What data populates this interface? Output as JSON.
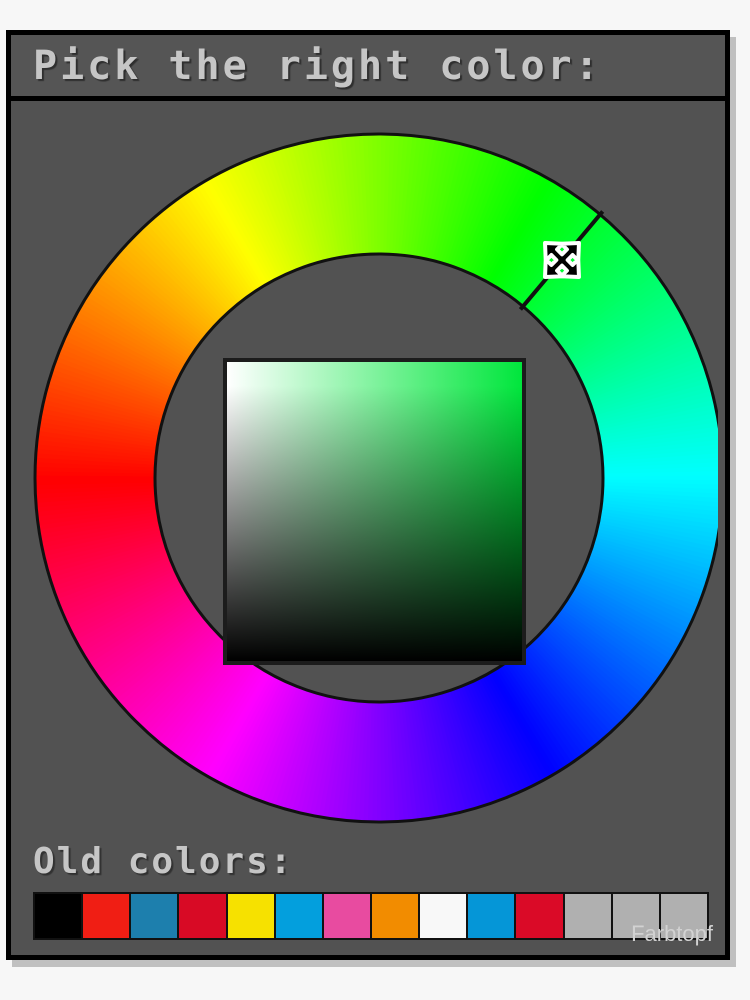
{
  "window": {
    "title": "Pick the right color:",
    "background_color": "#525252",
    "titlebar_color": "#555555",
    "border_color": "#000000",
    "text_color": "#c6c6c6",
    "page_background": "#f7f7f7"
  },
  "hue_wheel": {
    "name": "hue-ring",
    "selected_hue_degrees": 130,
    "selected_hue_color": "#00e63c",
    "outer_radius": 345,
    "inner_radius": 223,
    "stroke_color": "#111111",
    "cursor_icon": "move-resize-diagonal-cursor",
    "stops": [
      {
        "deg": 0,
        "color": "#ff0000"
      },
      {
        "deg": 30,
        "color": "#ff8000"
      },
      {
        "deg": 60,
        "color": "#ffff00"
      },
      {
        "deg": 90,
        "color": "#80ff00"
      },
      {
        "deg": 120,
        "color": "#00ff00"
      },
      {
        "deg": 150,
        "color": "#00ff80"
      },
      {
        "deg": 180,
        "color": "#00ffff"
      },
      {
        "deg": 210,
        "color": "#0080ff"
      },
      {
        "deg": 240,
        "color": "#0000ff"
      },
      {
        "deg": 270,
        "color": "#8000ff"
      },
      {
        "deg": 300,
        "color": "#ff00ff"
      },
      {
        "deg": 330,
        "color": "#ff0080"
      },
      {
        "deg": 360,
        "color": "#ff0000"
      }
    ]
  },
  "sv_square": {
    "name": "saturation-value-square",
    "hue_color": "#00e63c",
    "corner_white": "#ffffff",
    "corner_black": "#000000",
    "border_color": "#1c1c1c"
  },
  "old_colors": {
    "label": "Old colors:",
    "swatches": [
      {
        "name": "swatch-black",
        "color": "#000000"
      },
      {
        "name": "swatch-red",
        "color": "#f01e14"
      },
      {
        "name": "swatch-steel-blue",
        "color": "#1d7fad"
      },
      {
        "name": "swatch-crimson",
        "color": "#d80a25"
      },
      {
        "name": "swatch-yellow",
        "color": "#f6e100"
      },
      {
        "name": "swatch-cyan-blue",
        "color": "#039fdd"
      },
      {
        "name": "swatch-pink",
        "color": "#e84ba0"
      },
      {
        "name": "swatch-orange",
        "color": "#f28c00"
      },
      {
        "name": "swatch-white",
        "color": "#f8f8f8"
      },
      {
        "name": "swatch-blue",
        "color": "#0596d7"
      },
      {
        "name": "swatch-red-2",
        "color": "#da0a27"
      },
      {
        "name": "swatch-empty-1",
        "color": "#b0b0b0"
      },
      {
        "name": "swatch-empty-2",
        "color": "#b0b0b0"
      },
      {
        "name": "swatch-empty-3",
        "color": "#b0b0b0"
      }
    ]
  },
  "watermark": {
    "text": "Farbtopf"
  }
}
